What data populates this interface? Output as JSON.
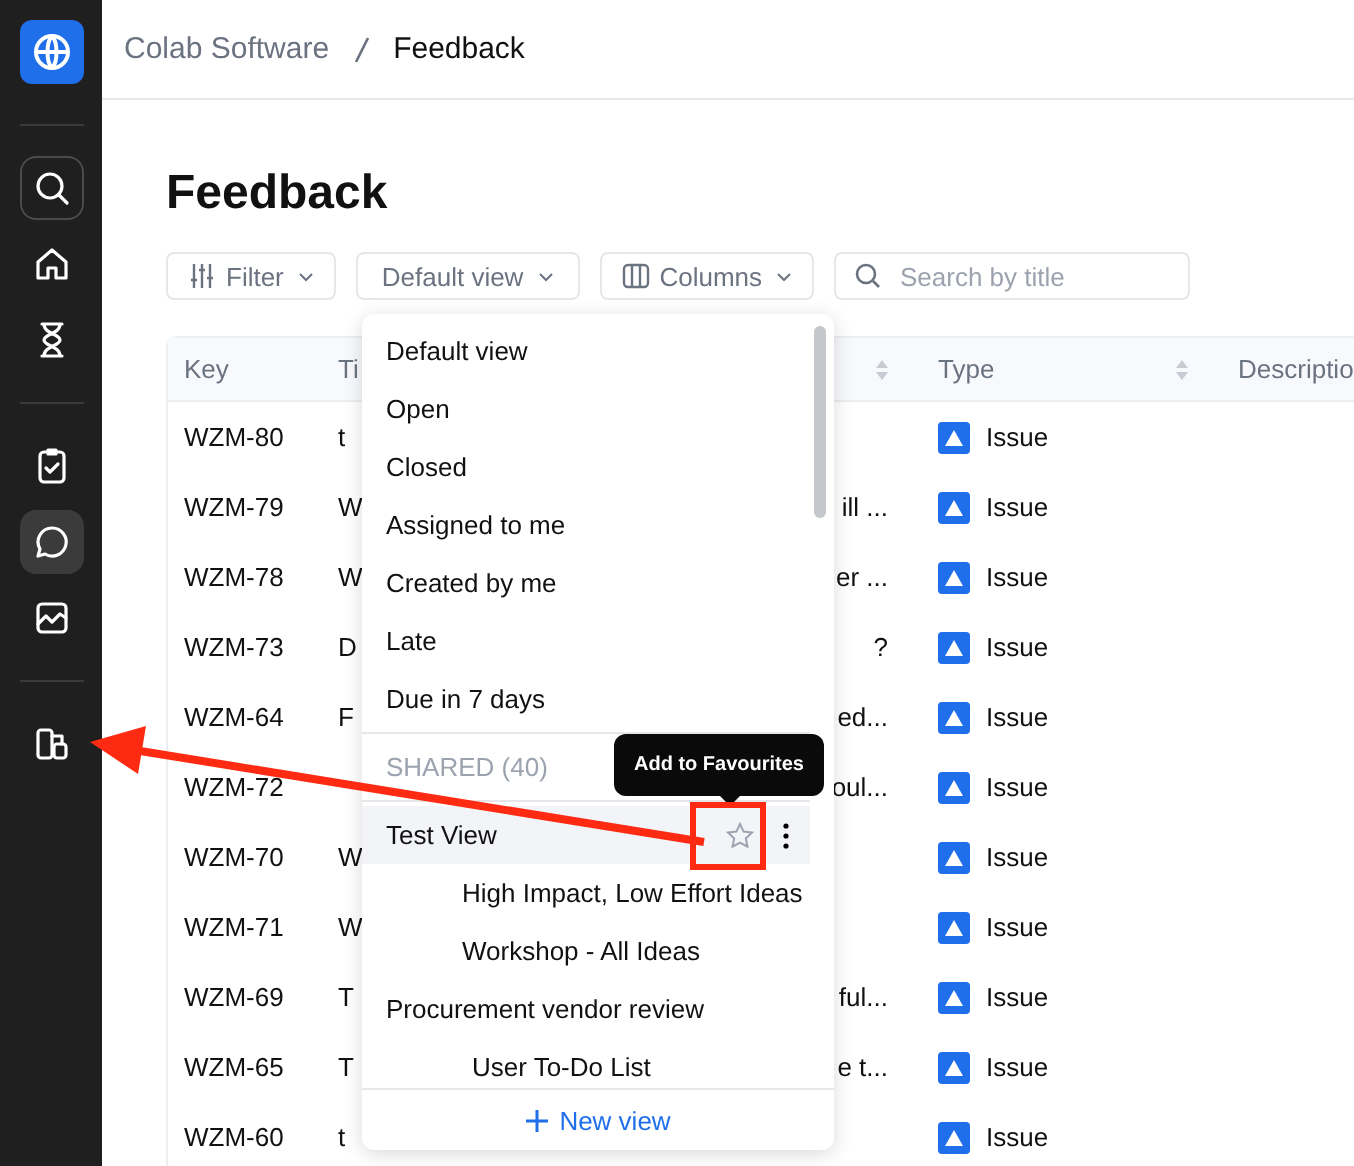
{
  "sidebar": {
    "groups": [
      [
        {
          "selected": false
        },
        {
          "selected": false
        },
        {
          "selected": false
        }
      ],
      [
        {
          "selected": false
        },
        {
          "selected": true
        },
        {
          "selected": false
        }
      ],
      [
        {
          "selected": false
        }
      ]
    ]
  },
  "breadcrumb": [
    "Colab Software",
    "Feedback"
  ],
  "page_title": "Feedback",
  "toolbar": {
    "filter": "Filter",
    "view": "Default view",
    "columns": "Columns",
    "search": {
      "placeholder": "Search by title"
    }
  },
  "table": {
    "columns": [
      "Key",
      "Ti",
      "Type",
      "Descriptio"
    ],
    "rows": [
      {
        "key": "WZM-80",
        "title_left": "t",
        "type": "Issue"
      },
      {
        "key": "WZM-79",
        "title_left": "W",
        "title_right": "ill ...",
        "type": "Issue"
      },
      {
        "key": "WZM-78",
        "title_left": "W",
        "title_right": "er ...",
        "type": "Issue"
      },
      {
        "key": "WZM-73",
        "title_left": "D",
        "title_right": "?",
        "type": "Issue"
      },
      {
        "key": "WZM-64",
        "title_left": "F",
        "title_right": "ed...",
        "type": "Issue"
      },
      {
        "key": "WZM-72",
        "title_right": "oul...",
        "type": "Issue"
      },
      {
        "key": "WZM-70",
        "title_left": "W",
        "type": "Issue"
      },
      {
        "key": "WZM-71",
        "title_left": "W",
        "type": "Issue"
      },
      {
        "key": "WZM-69",
        "title_left": "T",
        "title_right": "ful...",
        "type": "Issue"
      },
      {
        "key": "WZM-65",
        "title_left": "T",
        "title_right": "e t...",
        "type": "Issue"
      },
      {
        "key": "WZM-60",
        "title_left": "t",
        "type": "Issue"
      }
    ]
  },
  "view_menu": {
    "items": [
      "Default view",
      "Open",
      "Closed",
      "Assigned to me",
      "Created by me",
      "Late",
      "Due in 7 days"
    ],
    "shared_heading": "SHARED (40)",
    "shared": [
      {
        "label": "Test View",
        "highlighted": true,
        "children": [
          {
            "label": "High Impact, Low Effort Ideas"
          },
          {
            "label": "Workshop - All Ideas"
          }
        ]
      },
      {
        "label": "Procurement vendor review",
        "highlighted": false,
        "children": [
          {
            "label": "User To-Do List"
          }
        ]
      }
    ],
    "new_view": "New view"
  },
  "tooltip": "Add to Favourites"
}
